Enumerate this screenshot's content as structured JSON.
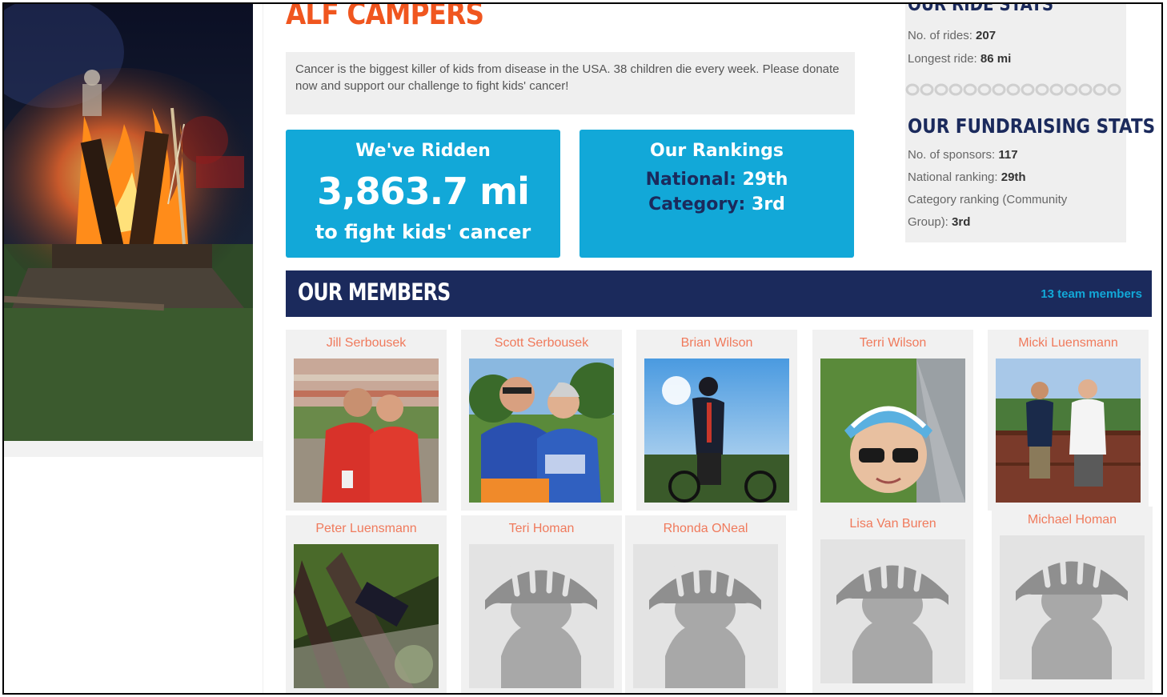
{
  "team": {
    "title": "ALF CAMPERS",
    "intro": "Cancer is the biggest killer of kids from disease in the USA. 38 children die every week. Please donate now and support our challenge to fight kids' cancer!"
  },
  "ridden_tile": {
    "heading": "We've Ridden",
    "distance": "3,863.7 mi",
    "tagline": "to fight kids' cancer"
  },
  "rankings_tile": {
    "heading": "Our Rankings",
    "national_label": "National:",
    "national_value": "29th",
    "category_label": "Category:",
    "category_value": "3rd"
  },
  "ride_stats": {
    "heading": "OUR RIDE STATS",
    "rides_label": "No. of rides:",
    "rides_value": "207",
    "longest_label": "Longest ride:",
    "longest_value": "86 mi"
  },
  "fundraising_stats": {
    "heading": "OUR FUNDRAISING STATS",
    "sponsors_label": "No. of sponsors:",
    "sponsors_value": "117",
    "national_label": "National ranking:",
    "national_value": "29th",
    "category_label_1": "Category ranking (Community",
    "category_label_2": "Group):",
    "category_value": "3rd"
  },
  "members": {
    "heading": "OUR MEMBERS",
    "count_link": "13 team members",
    "list": [
      {
        "name": "Jill Serbousek",
        "photo": "stadium-selfie"
      },
      {
        "name": "Scott Serbousek",
        "photo": "cycling-jerseys"
      },
      {
        "name": "Brian Wilson",
        "photo": "silhouette-bike"
      },
      {
        "name": "Terri Wilson",
        "photo": "helmet-selfie"
      },
      {
        "name": "Micki Luensmann",
        "photo": "bridge-pair"
      },
      {
        "name": "Peter Luensmann",
        "photo": "tree-trunks"
      },
      {
        "name": "Teri Homan",
        "photo": "default-avatar"
      },
      {
        "name": "Rhonda ONeal",
        "photo": "default-avatar"
      },
      {
        "name": "Lisa Van Buren",
        "photo": "default-avatar"
      },
      {
        "name": "Michael Homan",
        "photo": "default-avatar"
      }
    ]
  },
  "colors": {
    "accent_orange": "#f0561f",
    "tile_blue": "#12a8d8",
    "navy": "#1b2a5c",
    "name_salmon": "#f07a5c"
  }
}
